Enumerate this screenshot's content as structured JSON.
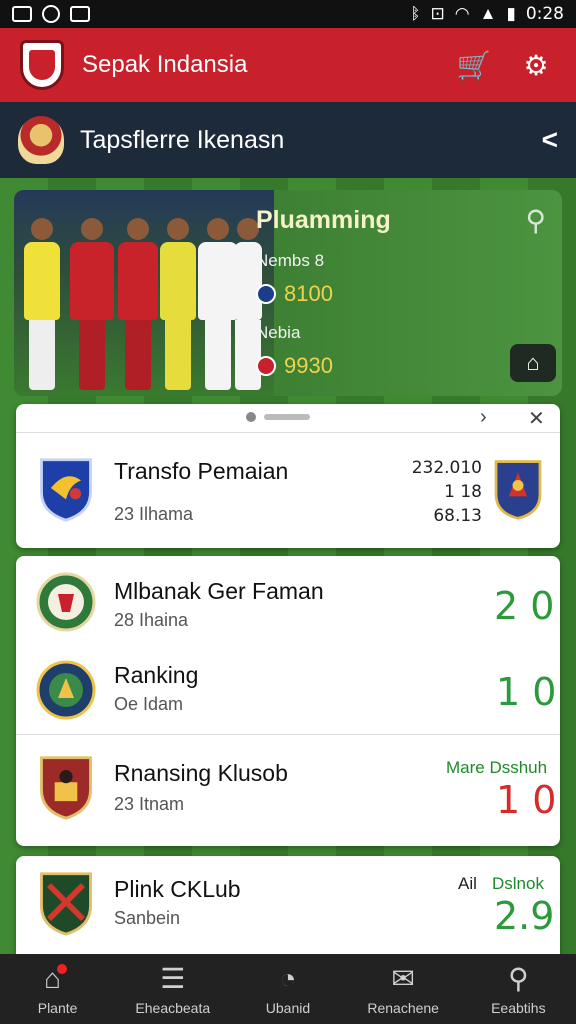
{
  "status_bar": {
    "time": "0:28",
    "left_icons": [
      "image-icon",
      "messenger-icon",
      "chat-icon"
    ],
    "right_icons": [
      "vibrate-icon",
      "nfc-icon",
      "wifi-icon",
      "signal-icon",
      "battery-icon"
    ]
  },
  "app_bar": {
    "title": "Sepak Indansia",
    "actions": [
      "cart-icon",
      "settings-icon"
    ]
  },
  "sub_bar": {
    "title": "Tapsflerre Ikenasn"
  },
  "hero": {
    "title": "Pluamming",
    "line1": "Nembs 8",
    "value1": "8100",
    "line2": "Nebia",
    "value2": "9930"
  },
  "top_card": {
    "title": "Transfo Pemaian",
    "subtitle": "23 Ilhama",
    "stats": [
      "232.010",
      "1 18",
      "68.13"
    ]
  },
  "mid_card": {
    "rows": [
      {
        "title": "Mlbanak Ger Faman",
        "subtitle": "28 Ihaina",
        "score": "2 0"
      },
      {
        "title": "Ranking",
        "subtitle": "Oe Idam",
        "score": "1 0"
      },
      {
        "title": "Rnansing Klusob",
        "subtitle": "23 Itnam",
        "score": "1 0",
        "tag": "Mare Dsshuh"
      }
    ]
  },
  "bottom_card": {
    "title": "Plink CKLub",
    "subtitle": "Sanbein",
    "score": "2.9",
    "tag_left": "Ail",
    "tag_right": "Dslnok"
  },
  "bottom_nav": [
    {
      "label": "Plante",
      "icon": "home-icon"
    },
    {
      "label": "Eheacbeata",
      "icon": "list-icon"
    },
    {
      "label": "Ubanid",
      "icon": "clock-icon"
    },
    {
      "label": "Renachene",
      "icon": "mail-icon"
    },
    {
      "label": "Eeabtihs",
      "icon": "search-icon"
    }
  ],
  "colors": {
    "brand_red": "#c8212b",
    "navy": "#1d2a3a",
    "score_green": "#2c9a3a",
    "score_red": "#d52b2b"
  }
}
